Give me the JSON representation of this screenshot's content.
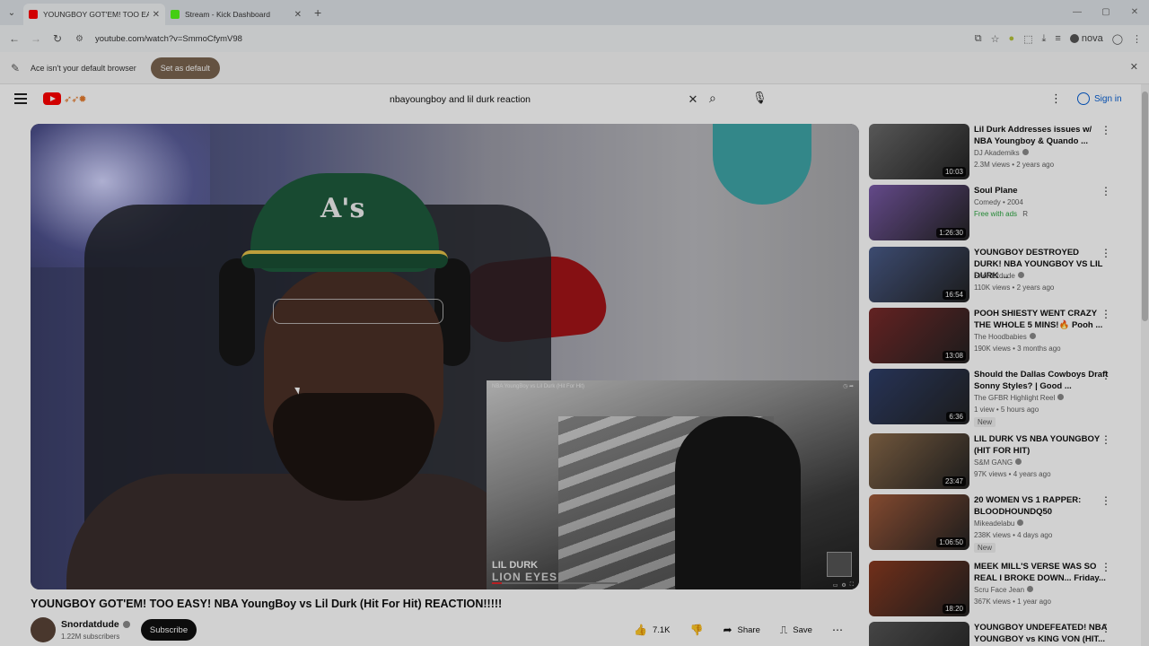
{
  "browser": {
    "tabs": [
      {
        "title": "YOUNGBOY GOT'EM! TOO EASY! NBA",
        "favicon_color": "#ff0000"
      },
      {
        "title": "Stream - Kick Dashboard",
        "favicon_color": "#53fc18"
      }
    ],
    "url": "youtube.com/watch?v=SmmoCfymV98",
    "profile": "nova",
    "infobar_message": "Ace isn't your default browser",
    "infobar_button": "Set as default"
  },
  "header": {
    "search_query": "nbayoungboy and lil durk reaction",
    "sign_in": "Sign in"
  },
  "player": {
    "pip_title": "NBA YoungBoy vs Lil Durk (Hit For Hit)",
    "pip_artist": "LIL DURK",
    "pip_song": "LION EYES",
    "progress": 0.08
  },
  "video": {
    "title": "YOUNGBOY GOT'EM! TOO EASY! NBA YoungBoy vs Lil Durk (Hit For Hit) REACTION!!!!!",
    "channel": "Snordatdude",
    "subscribers": "1.22M subscribers",
    "subscribe_label": "Subscribe",
    "likes": "7.1K",
    "share_label": "Share",
    "save_label": "Save"
  },
  "recommendations": [
    {
      "title": "Lil Durk Addresses issues w/ NBA Youngboy & Quando ...",
      "channel": "DJ Akademiks",
      "meta": "2.3M views • 2 years ago",
      "duration": "10:03",
      "extra": "",
      "color": "#6b6b6b"
    },
    {
      "title": "Soul Plane",
      "channel": "Comedy • 2004",
      "meta": "",
      "duration": "1:26:30",
      "extra": "Free with ads",
      "extra2": "R",
      "color": "#7a5aa8"
    },
    {
      "title": "YOUNGBOY DESTROYED DURK! NBA YOUNGBOY VS LIL DURK ...",
      "channel": "Snordatdude",
      "meta": "110K views • 2 years ago",
      "duration": "16:54",
      "extra": "",
      "color": "#4a5c8a"
    },
    {
      "title": "POOH SHIESTY WENT CRAZY THE WHOLE 5 MINS!🔥 Pooh ...",
      "channel": "The Hoodbabies",
      "meta": "190K views • 3 months ago",
      "duration": "13:08",
      "extra": "",
      "color": "#7a2a2a"
    },
    {
      "title": "Should the Dallas Cowboys Draft Sonny Styles? | Good ...",
      "channel": "The GFBR Highlight Reel",
      "meta": "1 view • 5 hours ago",
      "duration": "6:36",
      "extra": "New",
      "color": "#2f3f6a"
    },
    {
      "title": "LIL DURK VS NBA YOUNGBOY (HIT FOR HIT)",
      "channel": "S&M GANG",
      "meta": "97K views • 4 years ago",
      "duration": "23:47",
      "extra": "",
      "color": "#8a6a4a"
    },
    {
      "title": "20 WOMEN VS 1 RAPPER: BLOODHOUNDQ50",
      "channel": "Mikeadelabu",
      "meta": "238K views • 4 days ago",
      "duration": "1:06:50",
      "extra": "New",
      "color": "#a05a3a"
    },
    {
      "title": "MEEK MILL'S VERSE WAS SO REAL I BROKE DOWN... Friday...",
      "channel": "Scru Face Jean",
      "meta": "367K views • 1 year ago",
      "duration": "18:20",
      "extra": "",
      "color": "#8a3a20"
    },
    {
      "title": "YOUNGBOY UNDEFEATED! NBA YOUNGBOY vs KING VON (HIT...",
      "channel": "",
      "meta": "",
      "duration": "",
      "extra": "",
      "color": "#555555"
    }
  ]
}
